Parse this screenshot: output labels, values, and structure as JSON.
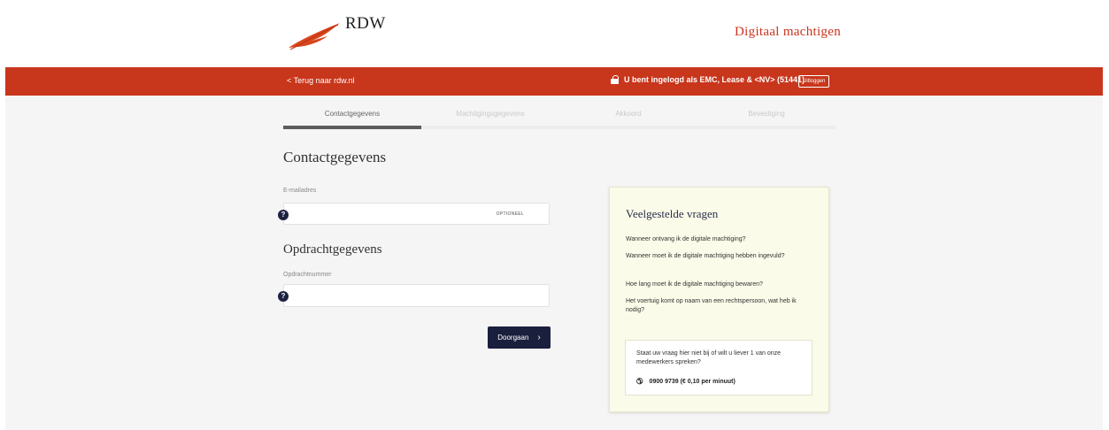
{
  "header": {
    "logo_text": "RDW",
    "app_title": "Digitaal machtigen",
    "brand_color": "#c8361c"
  },
  "navbar": {
    "back_link": "< Terug naar rdw.nl",
    "login_info": "U bent ingelogd als EMC, Lease & <NV> (51441)",
    "logout_label": "Uitloggen"
  },
  "steps": [
    {
      "label": "Contactgegevens",
      "active": true
    },
    {
      "label": "Machtigingsgegevens",
      "active": false
    },
    {
      "label": "Akkoord",
      "active": false
    },
    {
      "label": "Bevestiging",
      "active": false
    }
  ],
  "contact": {
    "heading": "Contactgegevens",
    "email_label": "E-mailadres",
    "email_value": "",
    "optional_tag": "OPTIONEEL"
  },
  "order": {
    "heading": "Opdrachtgegevens",
    "number_label": "Opdrachtnummer",
    "number_value": ""
  },
  "submit_label": "Doorgaan",
  "faq": {
    "title": "Veelgestelde vragen",
    "questions": [
      "Wanneer ontvang ik de digitale machtiging?",
      "Wanneer moet ik de digitale machtiging hebben ingevuld?",
      "Hoe lang moet ik de digitale machtiging bewaren?",
      "Het voertuig komt op naam van een rechtspersoon, wat heb ik nodig?"
    ],
    "contact_text": "Staat uw vraag hier niet bij of wilt u liever 1 van onze medewerkers spreken?",
    "phone": "0900 9739 (€ 0,10 per minuut)"
  },
  "icons": {
    "help": "question-circle-icon",
    "lock": "lock-icon",
    "phone": "phone-icon",
    "chevron": "chevron-right-icon"
  }
}
